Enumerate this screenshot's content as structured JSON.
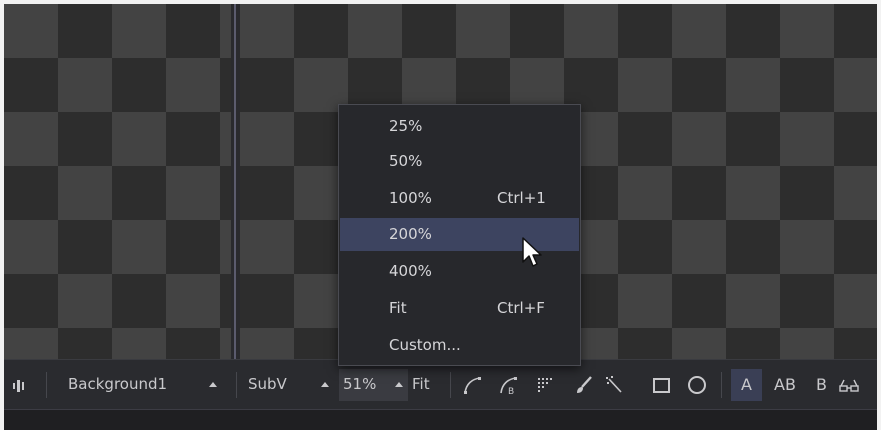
{
  "toolbar": {
    "background_label": "Background1",
    "subview_label": "SubV",
    "zoom_value": "51%",
    "fit_label": "Fit",
    "channel_a": "A",
    "channel_ab": "AB",
    "channel_b": "B"
  },
  "zoom_menu": {
    "items": [
      {
        "label": "25%",
        "shortcut": ""
      },
      {
        "label": "50%",
        "shortcut": ""
      },
      {
        "label": "100%",
        "shortcut": "Ctrl+1"
      },
      {
        "label": "200%",
        "shortcut": "",
        "selected": true
      },
      {
        "label": "400%",
        "shortcut": ""
      },
      {
        "label": "Fit",
        "shortcut": "Ctrl+F"
      },
      {
        "label": "Custom...",
        "shortcut": ""
      }
    ]
  },
  "colors": {
    "selection": "#3d4460",
    "menu_bg": "#27282c",
    "toolbar_bg": "#2a2b2f"
  },
  "icons": [
    "histogram-icon",
    "polygon-mask-icon",
    "bspline-mask-icon",
    "bitmap-mask-icon",
    "paint-brush-icon",
    "magic-wand-icon",
    "rectangle-mask-icon",
    "ellipse-mask-icon",
    "stereo-glasses-icon"
  ]
}
